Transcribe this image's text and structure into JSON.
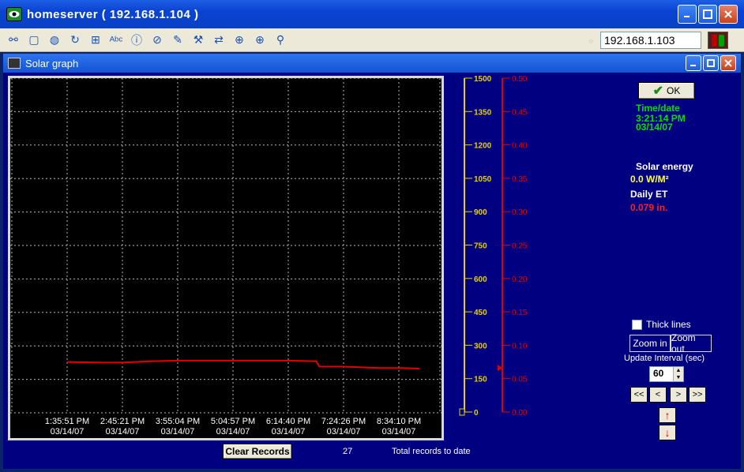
{
  "app": {
    "title": "homeserver ( 192.168.1.104 )",
    "ip_value": "192.168.1.103"
  },
  "toolbar": {
    "icons": [
      "network-icon",
      "window-icon",
      "globe-icon",
      "refresh-icon",
      "windows-icon",
      "spellcheck-icon",
      "info-icon",
      "globe-cancel-icon",
      "palette-icon",
      "tools-icon",
      "sync-icon",
      "target-icon",
      "target-edit-icon",
      "link-icon"
    ]
  },
  "window": {
    "title": "Solar graph"
  },
  "panel": {
    "ok_label": "OK",
    "time_label": "Time/date",
    "time_value": "3:21:14 PM",
    "date_value": "03/14/07",
    "solar_label": "Solar energy",
    "solar_value": "0.0 W/M²",
    "et_label": "Daily ET",
    "et_value": "0.079 in.",
    "thick_lines": "Thick lines",
    "zoom_in": "Zoom in",
    "zoom_out": "Zoom out",
    "update_label": "Update Interval (sec)",
    "update_value": "60",
    "nav": [
      "<<",
      "<",
      ">",
      ">>"
    ],
    "up_arrow": "↑",
    "down_arrow": "↓"
  },
  "footer": {
    "clear_label": "Clear Records",
    "record_count": "27",
    "record_label": "Total records to date"
  },
  "colors": {
    "solar_axis": "#e8d000",
    "et_axis": "#e00000",
    "grid": "#b8b8b8",
    "line": "#e00000"
  },
  "chart_data": {
    "type": "line",
    "x_tick_times": [
      "1:35:51 PM",
      "2:45:21 PM",
      "3:55:04 PM",
      "5:04:57 PM",
      "6:14:40 PM",
      "7:24:26 PM",
      "8:34:10 PM"
    ],
    "x_tick_dates": [
      "03/14/07",
      "03/14/07",
      "03/14/07",
      "03/14/07",
      "03/14/07",
      "03/14/07",
      "03/14/07"
    ],
    "y_left_ticks": [
      1500,
      1350,
      1200,
      1050,
      900,
      750,
      600,
      450,
      300,
      150,
      0
    ],
    "y_left_labels": [
      "1500",
      "1350",
      "1200",
      "1050",
      "900",
      "750",
      "600",
      "450",
      "300",
      "150",
      "0"
    ],
    "y_right_ticks": [
      0.5,
      0.45,
      0.4,
      0.35,
      0.3,
      0.25,
      0.2,
      0.15,
      0.1,
      0.05,
      0.0
    ],
    "y_right_labels": [
      "0.50",
      "0.45",
      "0.40",
      "0.35",
      "0.30",
      "0.25",
      "0.20",
      "0.15",
      "0.10",
      "0.05",
      "0.00"
    ],
    "ylim_left": [
      0,
      1500
    ],
    "ylim_right": [
      0,
      0.5
    ],
    "grid": true,
    "series": [
      {
        "axis": "right",
        "color": "#e00000",
        "x": [
          "1:35:51 PM",
          "2:20 PM",
          "2:45:21 PM",
          "3:20 PM",
          "3:55:04 PM",
          "5:04:57 PM",
          "6:14:40 PM",
          "6:50 PM",
          "6:54 PM",
          "7:24:26 PM",
          "8:10 PM",
          "8:34:10 PM",
          "9:00 PM"
        ],
        "values": [
          0.076,
          0.075,
          0.075,
          0.077,
          0.078,
          0.078,
          0.078,
          0.077,
          0.069,
          0.069,
          0.067,
          0.067,
          0.066
        ]
      }
    ]
  }
}
